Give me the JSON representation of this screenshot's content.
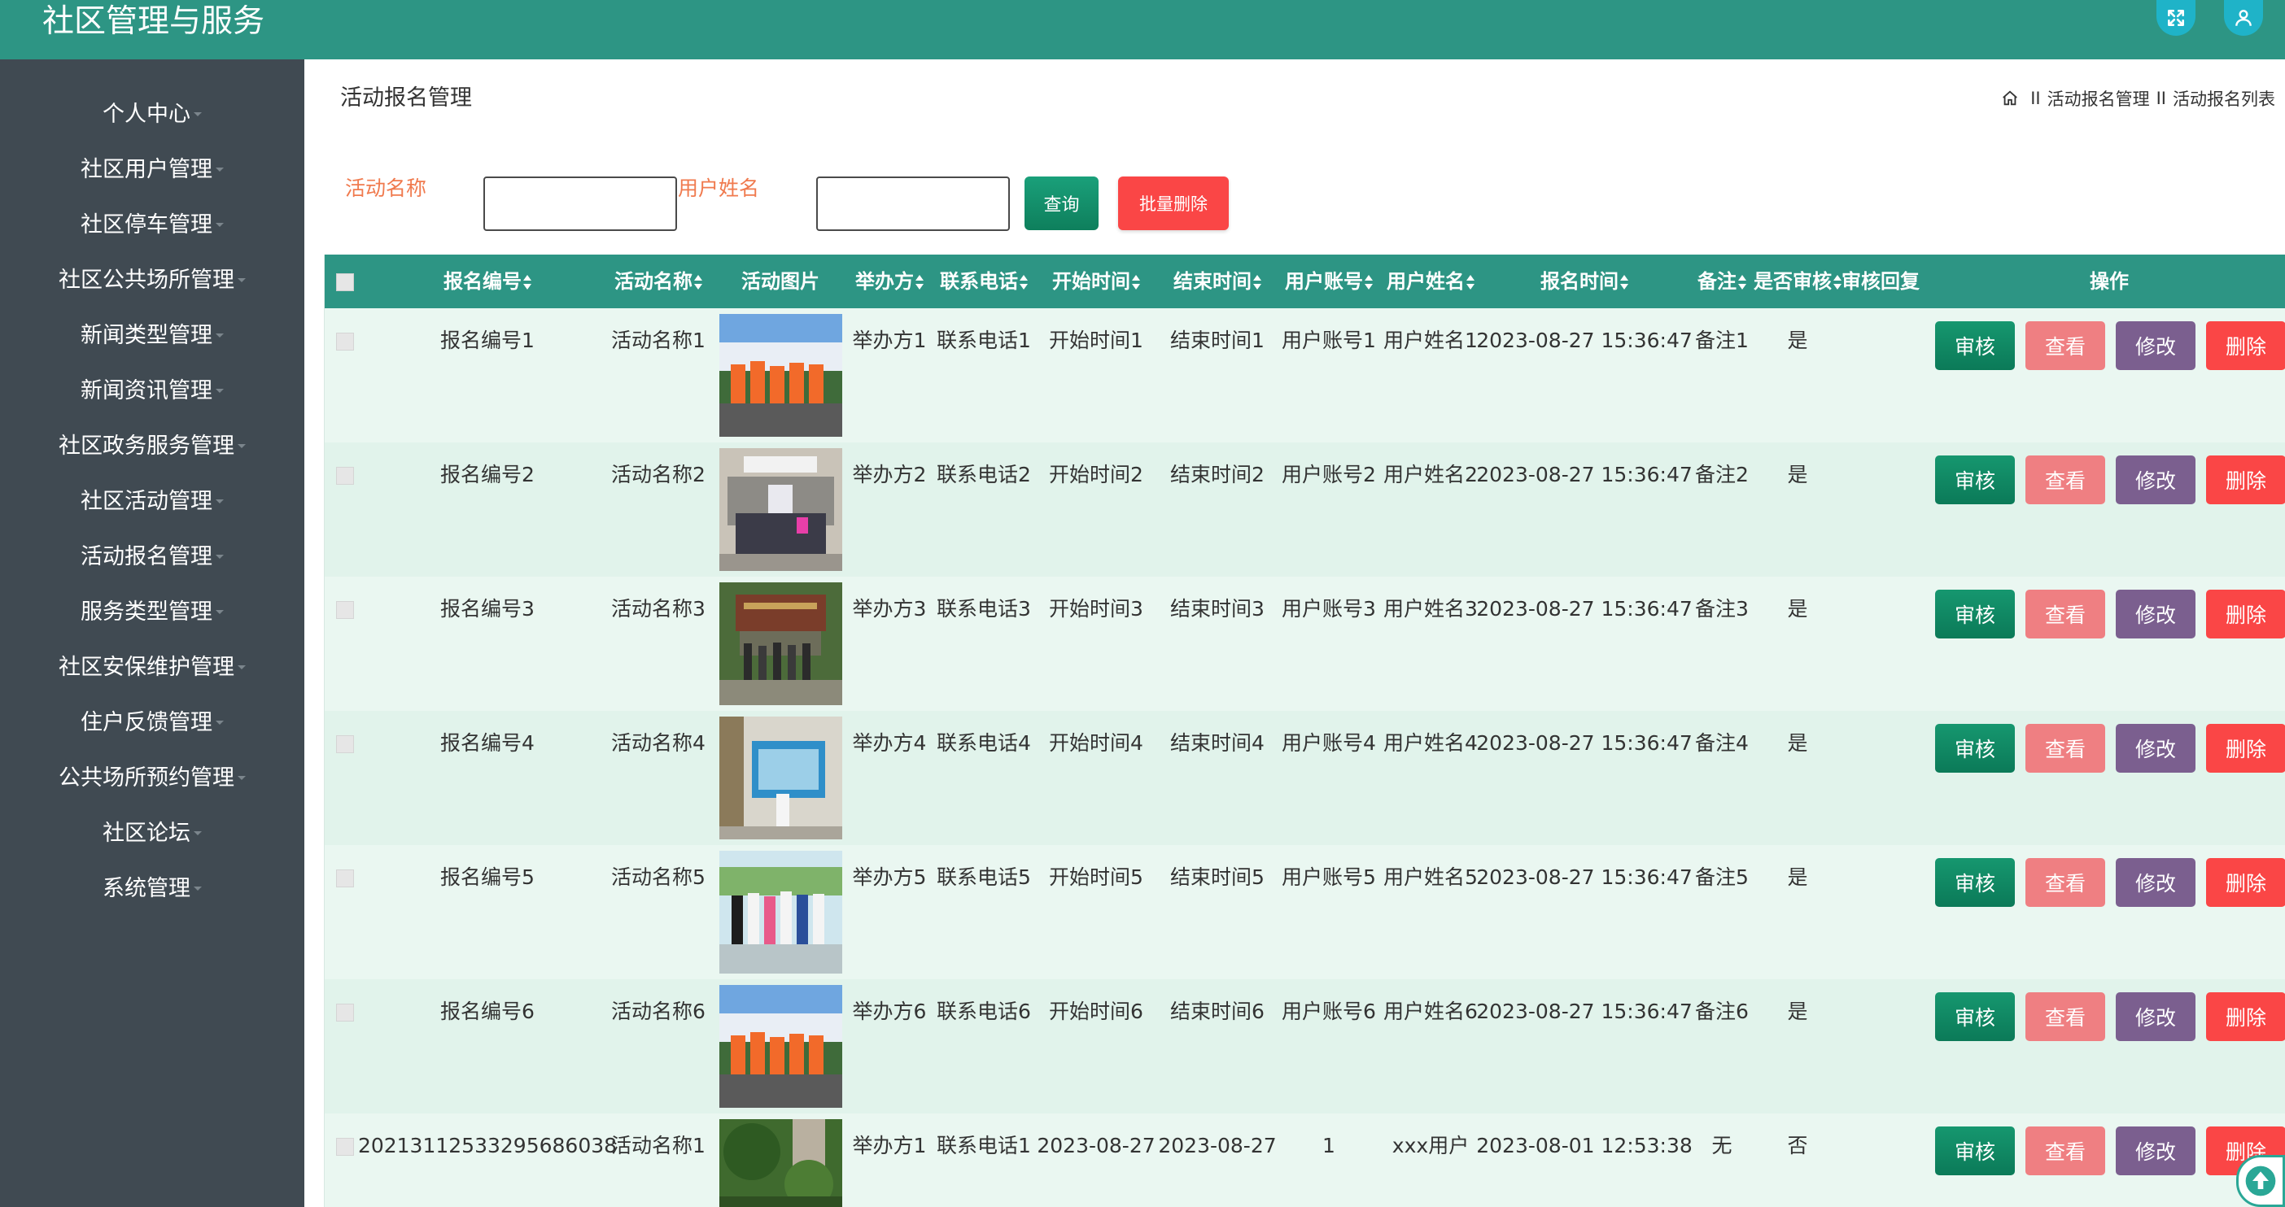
{
  "app": {
    "title": "社区管理与服务"
  },
  "sidebar": {
    "items": [
      {
        "label": "个人中心"
      },
      {
        "label": "社区用户管理"
      },
      {
        "label": "社区停车管理"
      },
      {
        "label": "社区公共场所管理"
      },
      {
        "label": "新闻类型管理"
      },
      {
        "label": "新闻资讯管理"
      },
      {
        "label": "社区政务服务管理"
      },
      {
        "label": "社区活动管理"
      },
      {
        "label": "活动报名管理"
      },
      {
        "label": "服务类型管理"
      },
      {
        "label": "社区安保维护管理"
      },
      {
        "label": "住户反馈管理"
      },
      {
        "label": "公共场所预约管理"
      },
      {
        "label": "社区论坛"
      },
      {
        "label": "系统管理"
      }
    ]
  },
  "page": {
    "title": "活动报名管理",
    "breadcrumb": [
      "活动报名管理",
      "活动报名列表"
    ],
    "breadcrumb_sep": "II"
  },
  "search": {
    "activity_label": "活动名称",
    "activity_value": "",
    "user_label": "用户姓名",
    "user_value": "",
    "query_button": "查询",
    "batch_delete_button": "批量删除"
  },
  "table": {
    "columns": [
      "报名编号",
      "活动名称",
      "活动图片",
      "举办方",
      "联系电话",
      "开始时间",
      "结束时间",
      "用户账号",
      "用户姓名",
      "报名时间",
      "备注",
      "是否审核",
      "审核回复",
      "操作"
    ],
    "actions": {
      "review": "审核",
      "view": "查看",
      "edit": "修改",
      "delete": "删除"
    },
    "rows": [
      {
        "id": "报名编号1",
        "activity": "活动名称1",
        "organizer": "举办方1",
        "phone": "联系电话1",
        "start": "开始时间1",
        "end": "结束时间1",
        "account": "用户账号1",
        "name": "用户姓名1",
        "signup_time": "2023-08-27 15:36:47",
        "note": "备注1",
        "audited": "是",
        "reply": ""
      },
      {
        "id": "报名编号2",
        "activity": "活动名称2",
        "organizer": "举办方2",
        "phone": "联系电话2",
        "start": "开始时间2",
        "end": "结束时间2",
        "account": "用户账号2",
        "name": "用户姓名2",
        "signup_time": "2023-08-27 15:36:47",
        "note": "备注2",
        "audited": "是",
        "reply": ""
      },
      {
        "id": "报名编号3",
        "activity": "活动名称3",
        "organizer": "举办方3",
        "phone": "联系电话3",
        "start": "开始时间3",
        "end": "结束时间3",
        "account": "用户账号3",
        "name": "用户姓名3",
        "signup_time": "2023-08-27 15:36:47",
        "note": "备注3",
        "audited": "是",
        "reply": ""
      },
      {
        "id": "报名编号4",
        "activity": "活动名称4",
        "organizer": "举办方4",
        "phone": "联系电话4",
        "start": "开始时间4",
        "end": "结束时间4",
        "account": "用户账号4",
        "name": "用户姓名4",
        "signup_time": "2023-08-27 15:36:47",
        "note": "备注4",
        "audited": "是",
        "reply": ""
      },
      {
        "id": "报名编号5",
        "activity": "活动名称5",
        "organizer": "举办方5",
        "phone": "联系电话5",
        "start": "开始时间5",
        "end": "结束时间5",
        "account": "用户账号5",
        "name": "用户姓名5",
        "signup_time": "2023-08-27 15:36:47",
        "note": "备注5",
        "audited": "是",
        "reply": ""
      },
      {
        "id": "报名编号6",
        "activity": "活动名称6",
        "organizer": "举办方6",
        "phone": "联系电话6",
        "start": "开始时间6",
        "end": "结束时间6",
        "account": "用户账号6",
        "name": "用户姓名6",
        "signup_time": "2023-08-27 15:36:47",
        "note": "备注6",
        "audited": "是",
        "reply": ""
      },
      {
        "id": "20213112533295686038",
        "activity": "活动名称1",
        "organizer": "举办方1",
        "phone": "联系电话1",
        "start": "2023-08-27",
        "end": "2023-08-27",
        "account": "1",
        "name": "xxx用户",
        "signup_time": "2023-08-01 12:53:38",
        "note": "无",
        "audited": "否",
        "reply": ""
      }
    ]
  },
  "colors": {
    "primary": "#2d9584",
    "sidebar": "#404a52",
    "danger": "#fa4646",
    "view": "#ef7f82",
    "edit": "#7b5f8f",
    "label": "#f07a4e"
  },
  "icons": {
    "fullscreen": "fullscreen-icon",
    "user": "user-icon",
    "home": "home-icon",
    "back_to_top": "arrow-up-icon"
  }
}
